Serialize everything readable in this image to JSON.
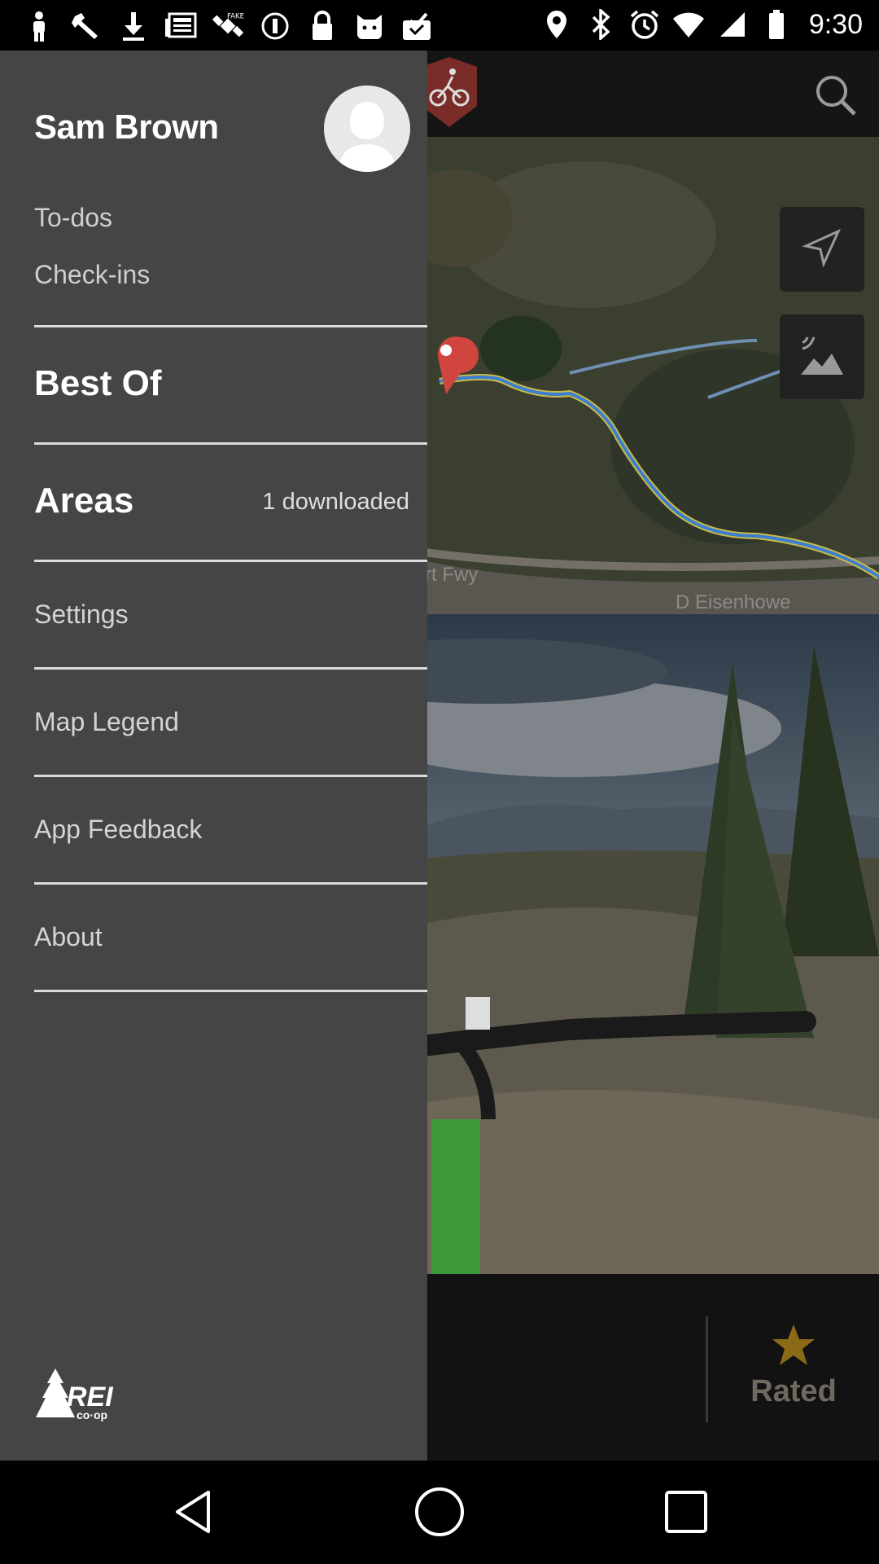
{
  "status_bar": {
    "time": "9:30",
    "icons_left": [
      "person-icon",
      "wrench-icon",
      "download-icon",
      "news-icon",
      "satellite-icon",
      "sync-icon",
      "lock-icon",
      "cat-icon",
      "inbox-check-icon"
    ],
    "icons_right": [
      "location-icon",
      "bluetooth-icon",
      "alarm-icon",
      "wifi-icon",
      "signal-icon",
      "battery-icon"
    ]
  },
  "app": {
    "map_labels": [
      "rt Fwy",
      "D Eisenhowe"
    ],
    "rated_label": "Rated"
  },
  "drawer": {
    "user_name": "Sam Brown",
    "todos": "To-dos",
    "checkins": "Check-ins",
    "best_of": "Best Of",
    "areas": "Areas",
    "areas_count": "1 downloaded",
    "settings": "Settings",
    "map_legend": "Map Legend",
    "app_feedback": "App Feedback",
    "about": "About",
    "logo_text": "REI co-op"
  },
  "colors": {
    "drawer_bg": "#454545",
    "trail_blue": "#3b7fd1",
    "trail_yellow": "#c9b94a",
    "marker_red": "#d0463e",
    "star": "#8a6a16"
  }
}
